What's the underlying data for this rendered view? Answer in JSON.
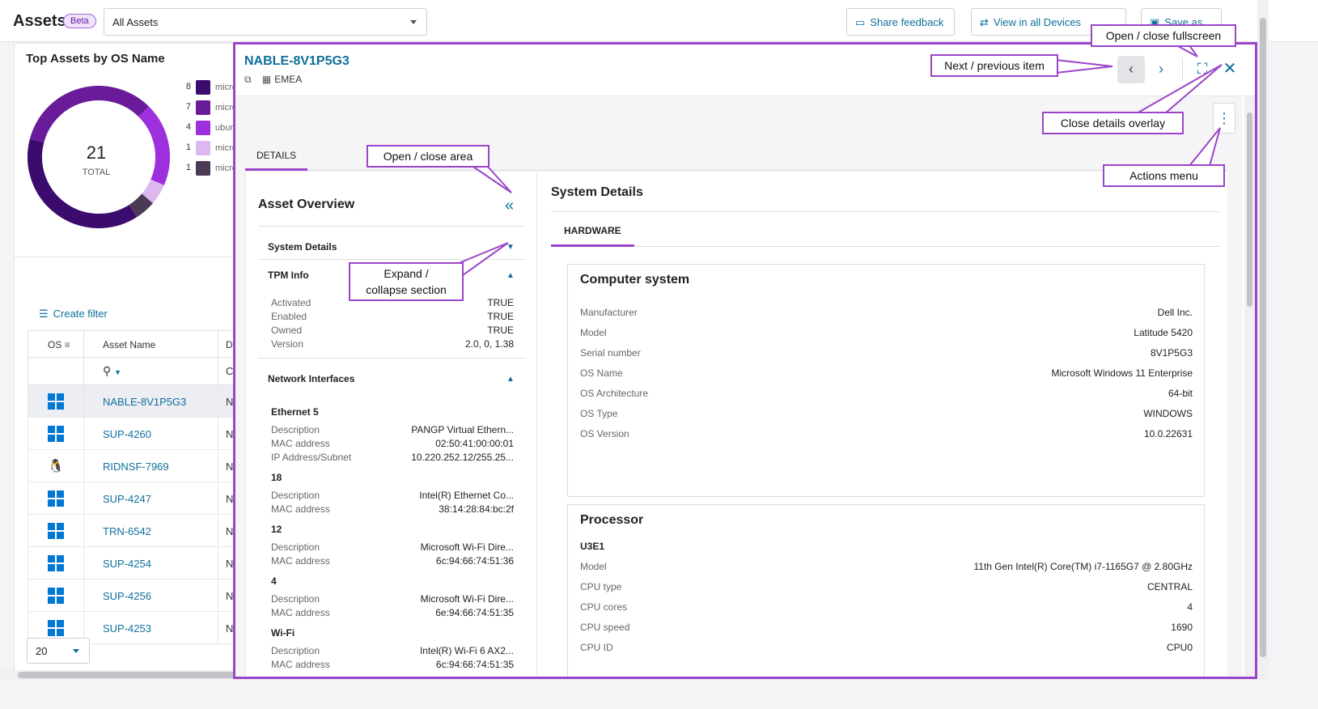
{
  "app": {
    "title": "Assets",
    "badge": "Beta",
    "asset_filter": "All Assets",
    "buttons": {
      "share_feedback": "Share feedback",
      "view_all_devices": "View in all Devices",
      "save_as": "Save as"
    }
  },
  "top_card": {
    "title": "Top Assets by OS Name",
    "total_value": "21",
    "total_label": "TOTAL",
    "legend": [
      {
        "count": "8",
        "label": "micro",
        "color": "#3b0b6e"
      },
      {
        "count": "7",
        "label": "micro",
        "color": "#6a1b9a"
      },
      {
        "count": "4",
        "label": "ubun",
        "color": "#9d2fdc"
      },
      {
        "count": "1",
        "label": "micro",
        "color": "#dbb8ee"
      },
      {
        "count": "1",
        "label": "micro",
        "color": "#4a3a55"
      }
    ]
  },
  "chart_data": {
    "type": "pie",
    "title": "Top Assets by OS Name",
    "categories": [
      "micro",
      "micro",
      "ubun",
      "micro",
      "micro"
    ],
    "values": [
      8,
      7,
      4,
      1,
      1
    ],
    "colors": [
      "#3b0b6e",
      "#6a1b9a",
      "#9d2fdc",
      "#dbb8ee",
      "#4a3a55"
    ],
    "total": 21
  },
  "grid": {
    "create_filter": "Create filter",
    "columns": {
      "os": "OS",
      "asset_name": "Asset Name",
      "d": "D"
    },
    "filter_c": "C",
    "rows": [
      {
        "name": "NABLE-8V1P5G3",
        "os": "windows",
        "d": "N"
      },
      {
        "name": "SUP-4260",
        "os": "windows",
        "d": "N"
      },
      {
        "name": "RIDNSF-7969",
        "os": "linux",
        "d": "N"
      },
      {
        "name": "SUP-4247",
        "os": "windows",
        "d": "N"
      },
      {
        "name": "TRN-6542",
        "os": "windows",
        "d": "N"
      },
      {
        "name": "SUP-4254",
        "os": "windows",
        "d": "N"
      },
      {
        "name": "SUP-4256",
        "os": "windows",
        "d": "N"
      },
      {
        "name": "SUP-4253",
        "os": "windows",
        "d": "N"
      }
    ],
    "page_size": "20"
  },
  "overlay": {
    "title": "NABLE-8V1P5G3",
    "region": "EMEA",
    "tab": "DETAILS",
    "left": {
      "title": "Asset Overview",
      "system_details": "System Details",
      "tpm_info": "TPM Info",
      "tpm": [
        {
          "k": "Activated",
          "v": "TRUE"
        },
        {
          "k": "Enabled",
          "v": "TRUE"
        },
        {
          "k": "Owned",
          "v": "TRUE"
        },
        {
          "k": "Version",
          "v": "2.0, 0, 1.38"
        }
      ],
      "network_interfaces": "Network Interfaces",
      "interfaces": [
        {
          "name": "Ethernet 5",
          "rows": [
            {
              "k": "Description",
              "v": "PANGP Virtual Ethern..."
            },
            {
              "k": "MAC address",
              "v": "02:50:41:00:00:01"
            },
            {
              "k": "IP Address/Subnet",
              "v": "10.220.252.12/255.25..."
            }
          ]
        },
        {
          "name": "18",
          "rows": [
            {
              "k": "Description",
              "v": "Intel(R) Ethernet Co..."
            },
            {
              "k": "MAC address",
              "v": "38:14:28:84:bc:2f"
            }
          ]
        },
        {
          "name": "12",
          "rows": [
            {
              "k": "Description",
              "v": "Microsoft Wi-Fi Dire..."
            },
            {
              "k": "MAC address",
              "v": "6c:94:66:74:51:36"
            }
          ]
        },
        {
          "name": "4",
          "rows": [
            {
              "k": "Description",
              "v": "Microsoft Wi-Fi Dire..."
            },
            {
              "k": "MAC address",
              "v": "6e:94:66:74:51:35"
            }
          ]
        },
        {
          "name": "Wi-Fi",
          "rows": [
            {
              "k": "Description",
              "v": "Intel(R) Wi-Fi 6 AX2..."
            },
            {
              "k": "MAC address",
              "v": "6c:94:66:74:51:35"
            }
          ]
        }
      ]
    },
    "right": {
      "title": "System Details",
      "tab": "HARDWARE",
      "computer_system": {
        "title": "Computer system",
        "rows": [
          {
            "k": "Manufacturer",
            "v": "Dell Inc."
          },
          {
            "k": "Model",
            "v": "Latitude 5420"
          },
          {
            "k": "Serial number",
            "v": "8V1P5G3"
          },
          {
            "k": "OS Name",
            "v": "Microsoft Windows 11 Enterprise"
          },
          {
            "k": "OS Architecture",
            "v": "64-bit"
          },
          {
            "k": "OS Type",
            "v": "WINDOWS"
          },
          {
            "k": "OS Version",
            "v": "10.0.22631"
          }
        ]
      },
      "processor": {
        "title": "Processor",
        "sub": "U3E1",
        "rows": [
          {
            "k": "Model",
            "v": "11th Gen Intel(R) Core(TM) i7-1165G7 @ 2.80GHz"
          },
          {
            "k": "CPU type",
            "v": "CENTRAL"
          },
          {
            "k": "CPU cores",
            "v": "4"
          },
          {
            "k": "CPU speed",
            "v": "1690"
          },
          {
            "k": "CPU ID",
            "v": "CPU0"
          }
        ]
      }
    }
  },
  "callouts": {
    "fullscreen": "Open / close fullscreen",
    "next_prev": "Next / previous item",
    "close_overlay": "Close details overlay",
    "actions_menu": "Actions menu",
    "open_close_area": "Open / close area",
    "expand_collapse": "Expand / collapse section"
  },
  "icons": {
    "filter": "filter-icon",
    "search": "search-icon",
    "copy": "copy-icon",
    "building": "building-icon",
    "chevron_left": "chevron-left-icon",
    "chevron_right": "chevron-right-icon",
    "fullscreen": "fullscreen-icon",
    "close": "close-icon",
    "kebab": "kebab-menu-icon",
    "double_chevron_left": "double-chevron-left-icon"
  },
  "colors": {
    "accent": "#9b45c8",
    "link": "#0f6f9c"
  }
}
